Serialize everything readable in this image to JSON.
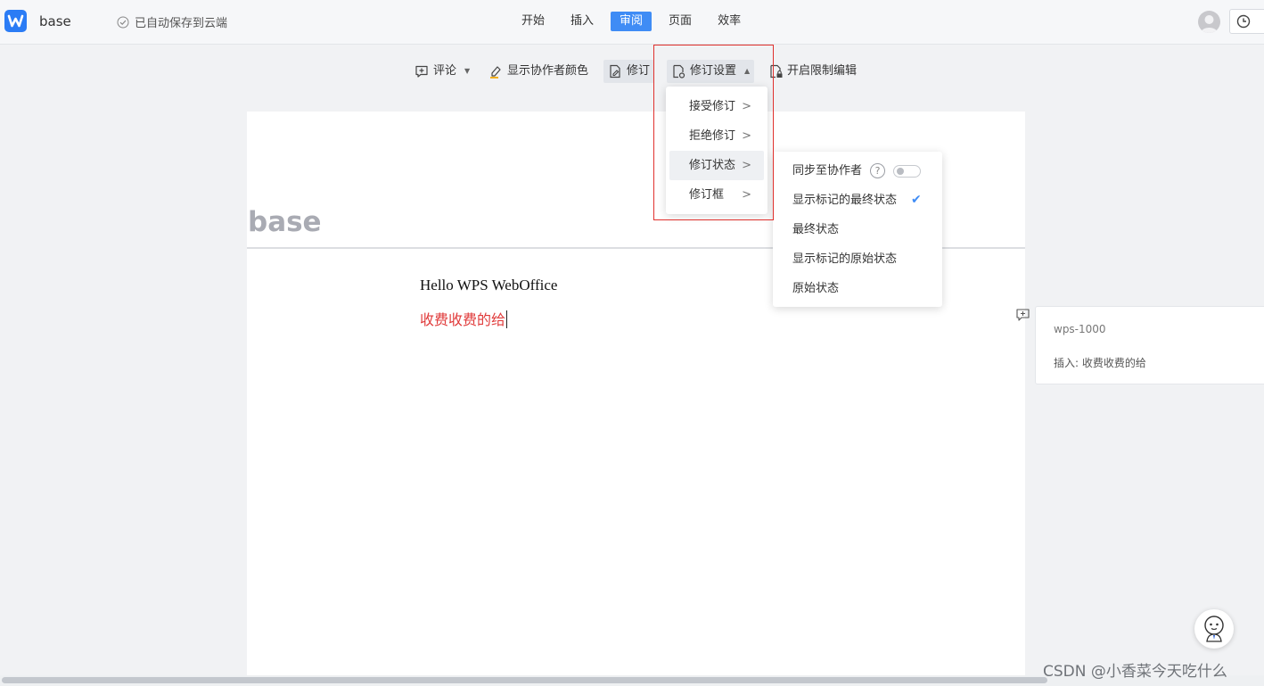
{
  "header": {
    "doc_name": "base",
    "save_status": "已自动保存到云端",
    "tabs": [
      {
        "label": "开始"
      },
      {
        "label": "插入"
      },
      {
        "label": "审阅"
      },
      {
        "label": "页面"
      },
      {
        "label": "效率"
      }
    ],
    "active_tab": "审阅"
  },
  "toolbar": {
    "comment_label": "评论",
    "show_author_color_label": "显示协作者颜色",
    "revise_label": "修订",
    "revise_settings_label": "修订设置",
    "restrict_edit_label": "开启限制编辑"
  },
  "revise_menu": {
    "items": [
      {
        "label": "接受修订"
      },
      {
        "label": "拒绝修订"
      },
      {
        "label": "修订状态"
      },
      {
        "label": "修订框"
      }
    ]
  },
  "revise_status_submenu": {
    "sync_label": "同步至协作者",
    "sync_enabled": false,
    "items": [
      {
        "label": "显示标记的最终状态",
        "checked": true
      },
      {
        "label": "最终状态",
        "checked": false
      },
      {
        "label": "显示标记的原始状态",
        "checked": false
      },
      {
        "label": "原始状态",
        "checked": false
      }
    ]
  },
  "document": {
    "title": "base",
    "line1": "Hello WPS WebOffice",
    "line2": "收费收费的给"
  },
  "comment": {
    "user": "wps-1000",
    "text": "插入: 收费收费的给"
  },
  "watermark": "CSDN @小香菜今天吃什么",
  "colors": {
    "accent": "#3f8cf5",
    "inserted_text": "#e03a3a",
    "highlight_box": "#e0312e"
  }
}
